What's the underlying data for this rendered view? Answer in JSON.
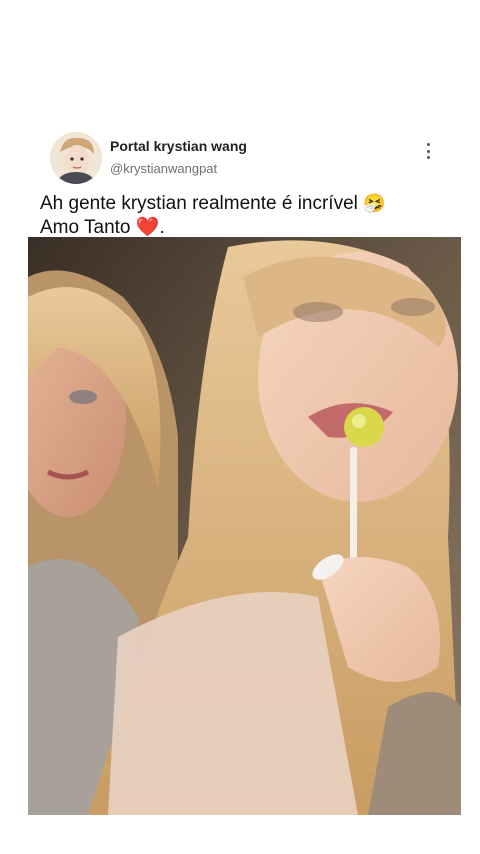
{
  "post": {
    "author_name": "Portal krystian wang",
    "author_handle": "@krystianwangpat",
    "caption_line1": "Ah gente krystian realmente é incrível",
    "caption_emoji1": "🤧",
    "caption_line2": "Amo Tanto",
    "caption_emoji2": "❤️",
    "caption_end": "."
  },
  "icons": {
    "more": "more-vertical-icon",
    "avatar": "profile-avatar"
  },
  "colors": {
    "background": "#ffffff",
    "handle_text": "#707070",
    "heart": "#d81f2c"
  }
}
